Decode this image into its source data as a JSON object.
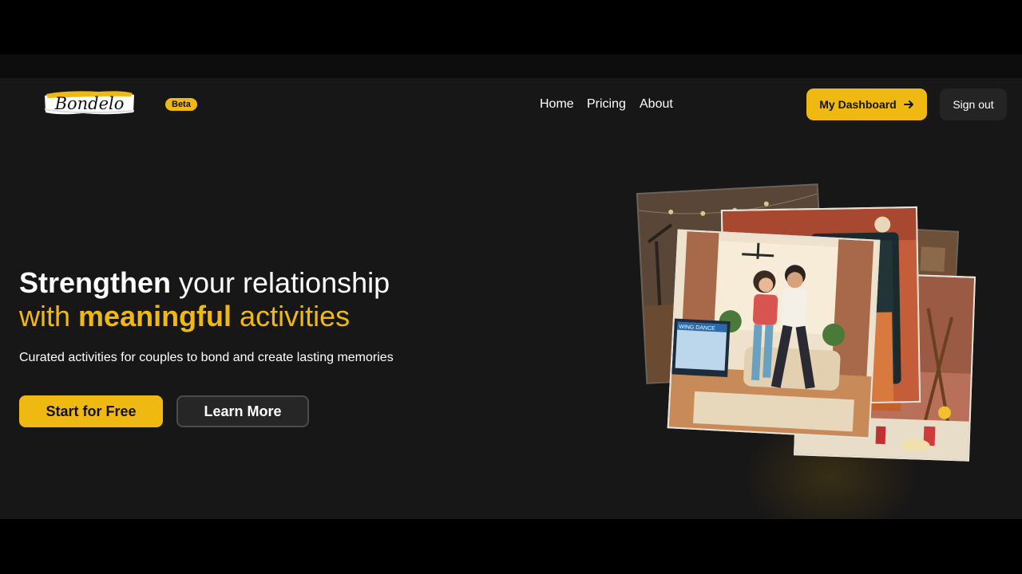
{
  "header": {
    "logo_text": "Bondelo",
    "badge": "Beta",
    "nav": [
      "Home",
      "Pricing",
      "About"
    ],
    "dashboard_label": "My Dashboard",
    "signout_label": "Sign out"
  },
  "hero": {
    "title_strong": "Strengthen",
    "title_rest": " your relationship",
    "line2_pre": "with ",
    "line2_strong": "meaningful",
    "line2_post": " activities",
    "subtitle": "Curated activities for couples to bond and create lasting memories",
    "start_label": "Start for Free",
    "learn_label": "Learn More"
  },
  "collage": {
    "screen_text": "WING DANCE"
  },
  "colors": {
    "accent": "#f0b912",
    "background": "#171717"
  },
  "icons": [
    "arrow-right-icon"
  ]
}
